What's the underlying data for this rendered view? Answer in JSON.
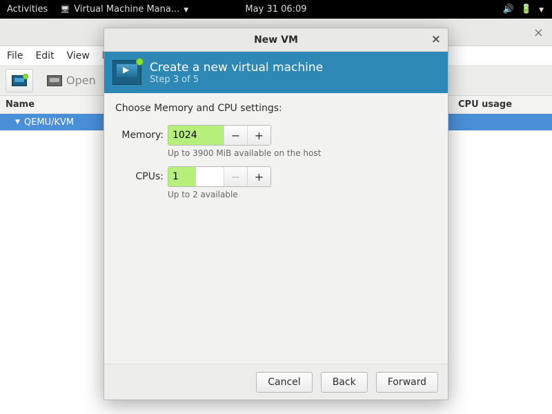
{
  "topbar": {
    "activities": "Activities",
    "appname": "Virtual Machine Mana...",
    "clock": "May 31 06:09"
  },
  "app": {
    "menus": {
      "file": "File",
      "edit": "Edit",
      "view": "View",
      "help": "H"
    },
    "toolbar": {
      "open": "Open"
    },
    "columns": {
      "name": "Name",
      "cpu": "CPU usage"
    },
    "rows": {
      "r0": "QEMU/KVM"
    }
  },
  "dialog": {
    "title": "New VM",
    "header_line1": "Create a new virtual machine",
    "header_line2": "Step 3 of 5",
    "body_title": "Choose Memory and CPU settings:",
    "memory_label": "Memory:",
    "memory_value": "1024",
    "memory_hint": "Up to 3900 MiB available on the host",
    "cpus_label": "CPUs:",
    "cpus_value": "1",
    "cpus_hint": "Up to 2 available",
    "buttons": {
      "cancel": "Cancel",
      "back": "Back",
      "forward": "Forward"
    }
  }
}
